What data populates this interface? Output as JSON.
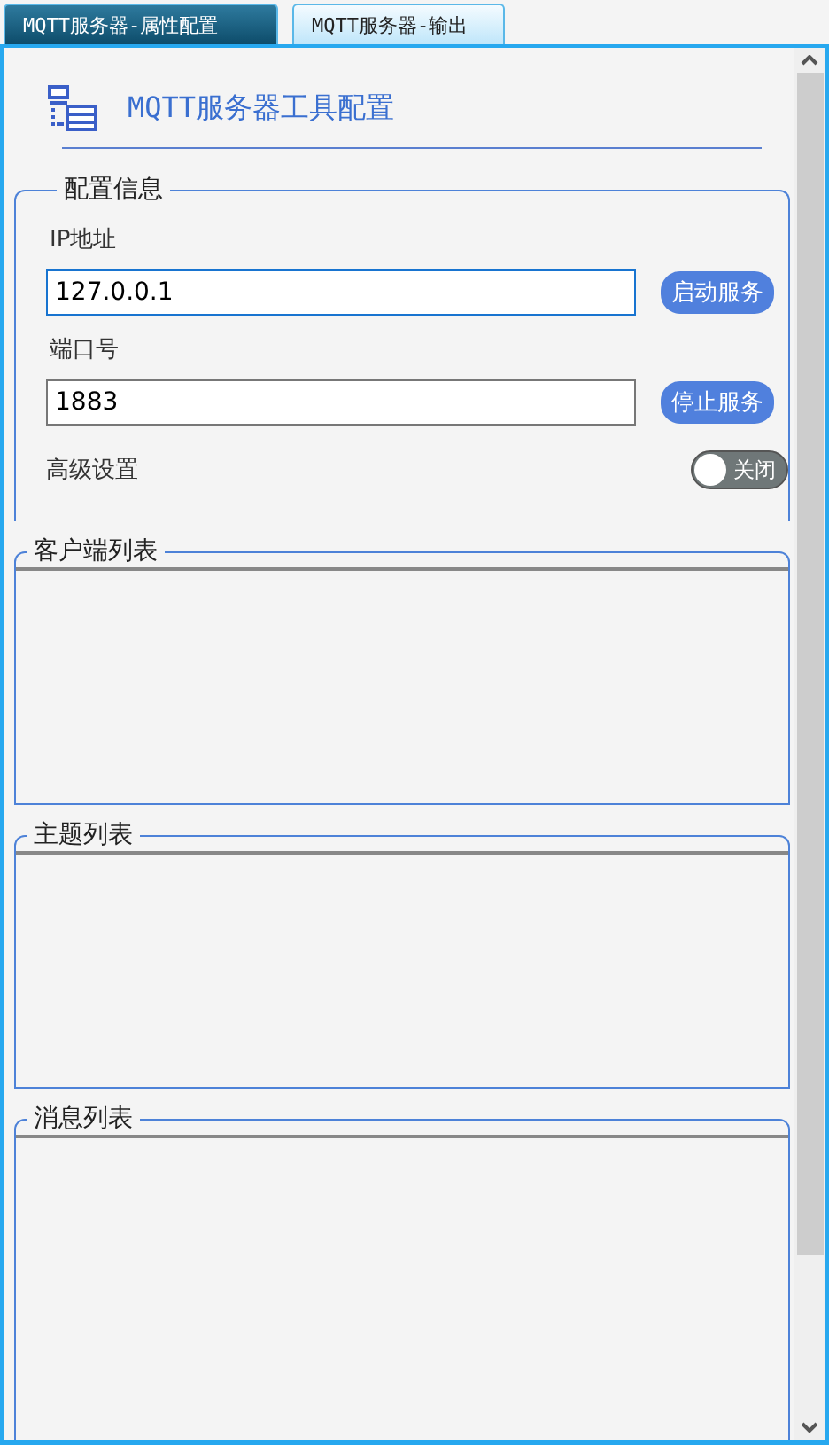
{
  "tabs": [
    {
      "label": "MQTT服务器-属性配置",
      "selected": true
    },
    {
      "label": "MQTT服务器-输出",
      "selected": false
    }
  ],
  "header": {
    "title": "MQTT服务器工具配置"
  },
  "config": {
    "title": "配置信息",
    "fields": [
      {
        "label": "IP地址",
        "value": "127.0.0.1",
        "focused": true,
        "button": "启动服务"
      },
      {
        "label": "端口号",
        "value": "1883",
        "focused": false,
        "button": "停止服务"
      }
    ],
    "advanced": {
      "label": "高级设置",
      "on": false,
      "text": "关闭"
    }
  },
  "lists": [
    {
      "title": "客户端列表"
    },
    {
      "title": "主题列表"
    },
    {
      "title": "消息列表"
    }
  ]
}
